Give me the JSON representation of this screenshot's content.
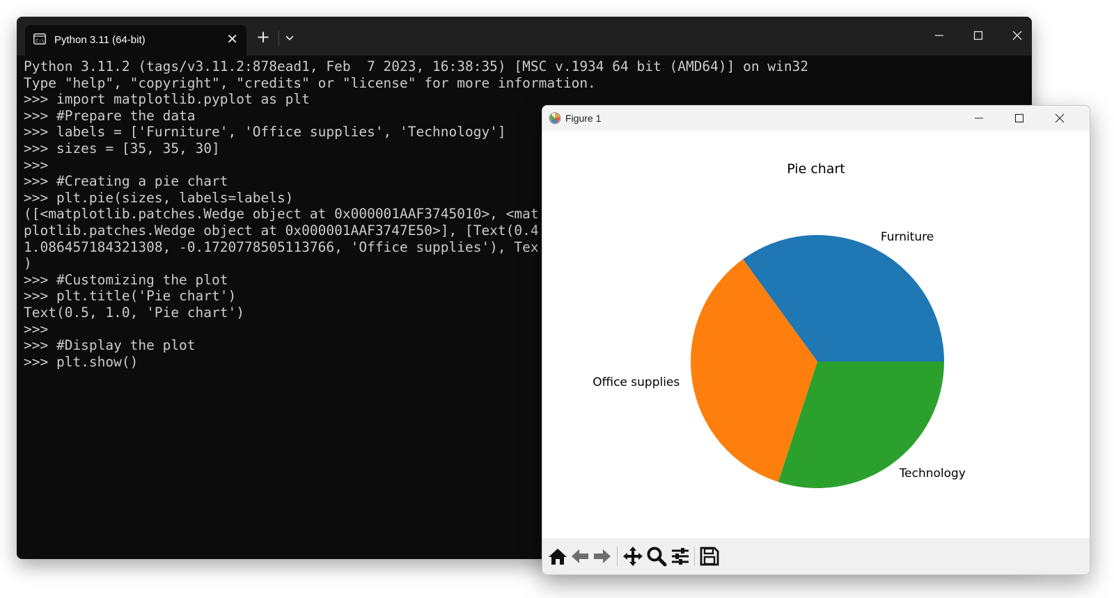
{
  "terminal": {
    "tab_title": "Python 3.11 (64-bit)",
    "tab_icon": "terminal-icon",
    "new_tab_label": "+",
    "lines": [
      "Python 3.11.2 (tags/v3.11.2:878ead1, Feb  7 2023, 16:38:35) [MSC v.1934 64 bit (AMD64)] on win32",
      "Type \"help\", \"copyright\", \"credits\" or \"license\" for more information.",
      ">>> import matplotlib.pyplot as plt",
      ">>> #Prepare the data",
      ">>> labels = ['Furniture', 'Office supplies', 'Technology']",
      ">>> sizes = [35, 35, 30]",
      ">>>",
      ">>> #Creating a pie chart",
      ">>> plt.pie(sizes, labels=labels)",
      "([<matplotlib.patches.Wedge object at 0x000001AAF3745010>, <mat",
      "plotlib.patches.Wedge object at 0x000001AAF3747E50>], [Text(0.4",
      "1.086457184321308, -0.1720778505113766, 'Office supplies'), Tex",
      ")",
      ">>> #Customizing the plot",
      ">>> plt.title('Pie chart')",
      "Text(0.5, 1.0, 'Pie chart')",
      ">>>",
      ">>> #Display the plot",
      ">>> plt.show()"
    ]
  },
  "figure": {
    "window_title": "Figure 1",
    "toolbar": [
      "home-icon",
      "back-arrow-icon",
      "forward-arrow-icon",
      "pan-icon",
      "zoom-icon",
      "configure-subplots-icon",
      "save-icon"
    ]
  },
  "chart_data": {
    "type": "pie",
    "title": "Pie chart",
    "labels": [
      "Furniture",
      "Office supplies",
      "Technology"
    ],
    "values": [
      35,
      35,
      30
    ],
    "colors": [
      "#1f77b4",
      "#ff7f0e",
      "#2ca02c"
    ],
    "startangle": 0,
    "direction": "counterclockwise"
  }
}
